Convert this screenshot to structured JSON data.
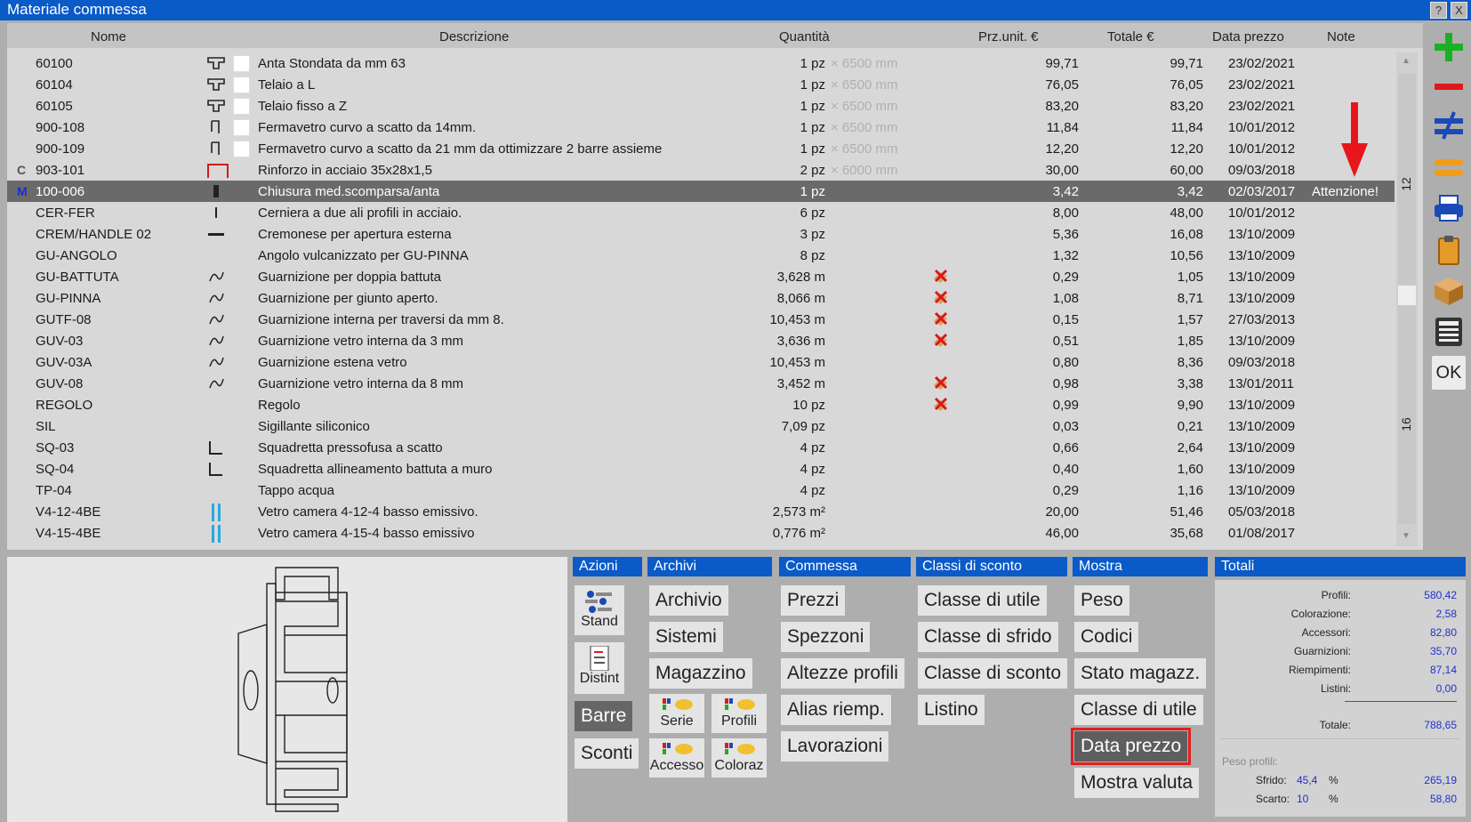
{
  "window": {
    "title": "Materiale commessa",
    "help_label": "?",
    "close_label": "X"
  },
  "columns": {
    "nome": "Nome",
    "descrizione": "Descrizione",
    "quantita": "Quantità",
    "prezzo": "Prz.unit. €",
    "totale": "Totale €",
    "data": "Data prezzo",
    "note": "Note"
  },
  "rows": [
    {
      "nome": "60100",
      "desc": "Anta Stondata da mm 63",
      "qty": "1 pz",
      "len": "× 6500 mm",
      "price": "99,71",
      "total": "99,71",
      "date": "23/02/2021",
      "note": "",
      "marker": "",
      "icon": "profile-icon",
      "box": true,
      "flag": false
    },
    {
      "nome": "60104",
      "desc": "Telaio a L",
      "qty": "1 pz",
      "len": "× 6500 mm",
      "price": "76,05",
      "total": "76,05",
      "date": "23/02/2021",
      "note": "",
      "marker": "",
      "icon": "profile-icon",
      "box": true,
      "flag": false
    },
    {
      "nome": "60105",
      "desc": "Telaio fisso a Z",
      "qty": "1 pz",
      "len": "× 6500 mm",
      "price": "83,20",
      "total": "83,20",
      "date": "23/02/2021",
      "note": "",
      "marker": "",
      "icon": "profile-icon",
      "box": true,
      "flag": false
    },
    {
      "nome": "900-108",
      "desc": "Fermavetro curvo a scatto da 14mm.",
      "qty": "1 pz",
      "len": "× 6500 mm",
      "price": "11,84",
      "total": "11,84",
      "date": "10/01/2012",
      "note": "",
      "marker": "",
      "icon": "glazing-bead-icon",
      "box": true,
      "flag": false
    },
    {
      "nome": "900-109",
      "desc": "Fermavetro curvo a scatto da 21 mm da ottimizzare 2 barre assieme",
      "qty": "1 pz",
      "len": "× 6500 mm",
      "price": "12,20",
      "total": "12,20",
      "date": "10/01/2012",
      "note": "",
      "marker": "",
      "icon": "glazing-bead-icon",
      "box": true,
      "flag": false
    },
    {
      "nome": "903-101",
      "desc": "Rinforzo in acciaio 35x28x1,5",
      "qty": "2 pz",
      "len": "× 6000 mm",
      "price": "30,00",
      "total": "60,00",
      "date": "09/03/2018",
      "note": "",
      "marker": "C",
      "icon": "steel-reinforcement-icon",
      "box": false,
      "flag": false
    },
    {
      "nome": "100-006",
      "desc": "Chiusura med.scomparsa/anta",
      "qty": "1 pz",
      "len": "",
      "price": "3,42",
      "total": "3,42",
      "date": "02/03/2017",
      "note": "Attenzione!",
      "marker": "M",
      "icon": "hardware-icon",
      "box": false,
      "flag": false
    },
    {
      "nome": "CER-FER",
      "desc": "Cerniera a due ali profili in acciaio.",
      "qty": "6 pz",
      "len": "",
      "price": "8,00",
      "total": "48,00",
      "date": "10/01/2012",
      "note": "",
      "marker": "",
      "icon": "hinge-icon",
      "box": false,
      "flag": false
    },
    {
      "nome": "CREM/HANDLE 02",
      "desc": "Cremonese per apertura esterna",
      "qty": "3 pz",
      "len": "",
      "price": "5,36",
      "total": "16,08",
      "date": "13/10/2009",
      "note": "",
      "marker": "",
      "icon": "handle-icon",
      "box": false,
      "flag": false
    },
    {
      "nome": "GU-ANGOLO",
      "desc": "Angolo vulcanizzato per GU-PINNA",
      "qty": "8 pz",
      "len": "",
      "price": "1,32",
      "total": "10,56",
      "date": "13/10/2009",
      "note": "",
      "marker": "",
      "icon": "",
      "box": false,
      "flag": false
    },
    {
      "nome": "GU-BATTUTA",
      "desc": "Guarnizione per doppia battuta",
      "qty": "3,628 m",
      "len": "",
      "price": "0,29",
      "total": "1,05",
      "date": "13/10/2009",
      "note": "",
      "marker": "",
      "icon": "gasket-icon",
      "box": false,
      "flag": true
    },
    {
      "nome": "GU-PINNA",
      "desc": "Guarnizione per giunto aperto.",
      "qty": "8,066 m",
      "len": "",
      "price": "1,08",
      "total": "8,71",
      "date": "13/10/2009",
      "note": "",
      "marker": "",
      "icon": "gasket-icon",
      "box": false,
      "flag": true
    },
    {
      "nome": "GUTF-08",
      "desc": "Guarnizione interna per traversi da mm 8.",
      "qty": "10,453 m",
      "len": "",
      "price": "0,15",
      "total": "1,57",
      "date": "27/03/2013",
      "note": "",
      "marker": "",
      "icon": "gasket-icon",
      "box": false,
      "flag": true
    },
    {
      "nome": "GUV-03",
      "desc": "Guarnizione vetro interna da 3 mm",
      "qty": "3,636 m",
      "len": "",
      "price": "0,51",
      "total": "1,85",
      "date": "13/10/2009",
      "note": "",
      "marker": "",
      "icon": "gasket-icon",
      "box": false,
      "flag": true
    },
    {
      "nome": "GUV-03A",
      "desc": "Guarnizione estena vetro",
      "qty": "10,453 m",
      "len": "",
      "price": "0,80",
      "total": "8,36",
      "date": "09/03/2018",
      "note": "",
      "marker": "",
      "icon": "gasket-icon",
      "box": false,
      "flag": false
    },
    {
      "nome": "GUV-08",
      "desc": "Guarnizione vetro interna da 8 mm",
      "qty": "3,452 m",
      "len": "",
      "price": "0,98",
      "total": "3,38",
      "date": "13/01/2011",
      "note": "",
      "marker": "",
      "icon": "gasket-icon",
      "box": false,
      "flag": true
    },
    {
      "nome": "REGOLO",
      "desc": "Regolo",
      "qty": "10 pz",
      "len": "",
      "price": "0,99",
      "total": "9,90",
      "date": "13/10/2009",
      "note": "",
      "marker": "",
      "icon": "",
      "box": false,
      "flag": true
    },
    {
      "nome": "SIL",
      "desc": "Sigillante siliconico",
      "qty": "7,09 pz",
      "len": "",
      "price": "0,03",
      "total": "0,21",
      "date": "13/10/2009",
      "note": "",
      "marker": "",
      "icon": "",
      "box": false,
      "flag": false
    },
    {
      "nome": "SQ-03",
      "desc": "Squadretta pressofusa a scatto",
      "qty": "4 pz",
      "len": "",
      "price": "0,66",
      "total": "2,64",
      "date": "13/10/2009",
      "note": "",
      "marker": "",
      "icon": "bracket-icon",
      "box": false,
      "flag": false
    },
    {
      "nome": "SQ-04",
      "desc": "Squadretta allineamento battuta a muro",
      "qty": "4 pz",
      "len": "",
      "price": "0,40",
      "total": "1,60",
      "date": "13/10/2009",
      "note": "",
      "marker": "",
      "icon": "bracket-icon",
      "box": false,
      "flag": false
    },
    {
      "nome": "TP-04",
      "desc": "Tappo acqua",
      "qty": "4 pz",
      "len": "",
      "price": "0,29",
      "total": "1,16",
      "date": "13/10/2009",
      "note": "",
      "marker": "",
      "icon": "",
      "box": false,
      "flag": false
    },
    {
      "nome": "V4-12-4BE",
      "desc": "Vetro camera 4-12-4 basso emissivo.",
      "qty": "2,573 m²",
      "len": "",
      "price": "20,00",
      "total": "51,46",
      "date": "05/03/2018",
      "note": "",
      "marker": "",
      "icon": "glass-icon",
      "box": false,
      "flag": false
    },
    {
      "nome": "V4-15-4BE",
      "desc": "Vetro camera 4-15-4 basso emissivo",
      "qty": "0,776 m²",
      "len": "",
      "price": "46,00",
      "total": "35,68",
      "date": "01/08/2017",
      "note": "",
      "marker": "",
      "icon": "glass-icon",
      "box": false,
      "flag": false
    }
  ],
  "scroll_markers": {
    "top": "12",
    "bottom": "16"
  },
  "selected_row": 6,
  "side_tools": [
    {
      "name": "add-icon"
    },
    {
      "name": "remove-icon"
    },
    {
      "name": "not-equal-icon"
    },
    {
      "name": "equal-icon"
    },
    {
      "name": "print-icon"
    },
    {
      "name": "clipboard-icon"
    },
    {
      "name": "box-icon"
    },
    {
      "name": "calculator-icon"
    }
  ],
  "ok_label": "OK",
  "panels": {
    "azioni": {
      "title": "Azioni",
      "stand": "Stand",
      "distint": "Distint",
      "barre": "Barre",
      "sconti": "Sconti"
    },
    "archivi": {
      "title": "Archivi",
      "archivio": "Archivio",
      "sistemi": "Sistemi",
      "magazzino": "Magazzino",
      "serie": "Serie",
      "profili": "Profili",
      "accesso": "Accesso",
      "coloraz": "Coloraz"
    },
    "commessa": {
      "title": "Commessa",
      "prezzi": "Prezzi",
      "spezzoni": "Spezzoni",
      "altezze": "Altezze profili",
      "alias": "Alias riemp.",
      "lavorazioni": "Lavorazioni"
    },
    "classi": {
      "title": "Classi di sconto",
      "utile": "Classe di utile",
      "sfrido": "Classe di sfrido",
      "sconto": "Classe di sconto",
      "listino": "Listino"
    },
    "mostra": {
      "title": "Mostra",
      "peso": "Peso",
      "codici": "Codici",
      "stato": "Stato magazz.",
      "classe_utile": "Classe di utile",
      "data_prezzo": "Data prezzo",
      "valuta": "Mostra valuta"
    }
  },
  "totals": {
    "title": "Totali",
    "profili_label": "Profili:",
    "profili": "580,42",
    "colorazione_label": "Colorazione:",
    "colorazione": "2,58",
    "accessori_label": "Accessori:",
    "accessori": "82,80",
    "guarnizioni_label": "Guarnizioni:",
    "guarnizioni": "35,70",
    "riempimenti_label": "Riempimenti:",
    "riempimenti": "87,14",
    "listini_label": "Listini:",
    "listini": "0,00",
    "totale_label": "Totale:",
    "totale": "788,65",
    "peso_label": "Peso profili:",
    "sfrido_label": "Sfrido:",
    "sfrido_pct": "45,4",
    "sfrido_val": "265,19",
    "scarto_label": "Scarto:",
    "scarto_pct": "10",
    "scarto_val": "58,80",
    "pct_symbol": "%"
  },
  "colors": {
    "accent": "#0a5ac8",
    "highlight_border": "#e02020",
    "value_blue": "#2030d0"
  }
}
